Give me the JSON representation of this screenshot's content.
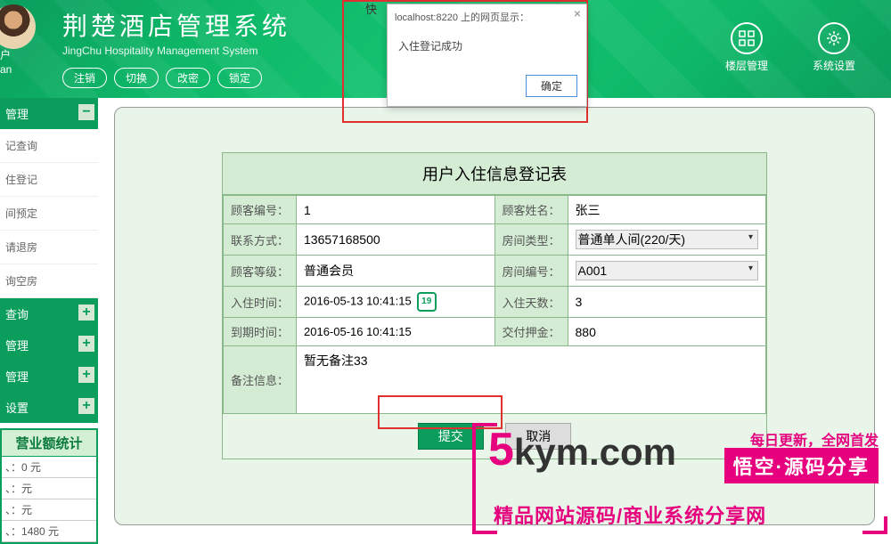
{
  "header": {
    "title": "荆楚酒店管理系统",
    "subtitle": "JingChu Hospitality Management System",
    "user_label_1": "户",
    "user_label_2": "an",
    "buttons": {
      "logout": "注销",
      "switch": "切换",
      "modify": "改密",
      "lock": "锁定"
    },
    "icons": {
      "floor": "楼层管理",
      "system": "系统设置"
    },
    "tab_hint": "快"
  },
  "alert": {
    "source": "localhost:8220 上的网页显示：",
    "message": "入住登记成功",
    "ok": "确定"
  },
  "sidebar": {
    "groups": [
      {
        "title": "管理",
        "expanded": true,
        "items": [
          "记查询",
          "住登记",
          "间预定",
          "请退房",
          "询空房"
        ]
      },
      {
        "title": "查询",
        "expanded": false
      },
      {
        "title": "管理",
        "expanded": false
      },
      {
        "title": "管理",
        "expanded": false
      },
      {
        "title": "设置",
        "expanded": false
      }
    ],
    "stats": {
      "title": "营业额统计",
      "rows": [
        {
          "label": "、：",
          "value": "0 元"
        },
        {
          "label": "、：",
          "value": "元"
        },
        {
          "label": "、：",
          "value": "元"
        },
        {
          "label": "、：",
          "value": "1480 元"
        }
      ]
    }
  },
  "form": {
    "title": "用户入住信息登记表",
    "labels": {
      "cust_id": "顾客编号：",
      "cust_name": "顾客姓名：",
      "contact": "联系方式：",
      "room_type": "房间类型：",
      "cust_level": "顾客等级：",
      "room_no": "房间编号：",
      "checkin": "入住时间：",
      "days": "入住天数：",
      "expire": "到期时间：",
      "deposit": "交付押金：",
      "remark": "备注信息："
    },
    "values": {
      "cust_id": "1",
      "cust_name": "张三",
      "contact": "13657168500",
      "room_type": "普通单人间(220/天)",
      "cust_level": "普通会员",
      "room_no": "A001",
      "checkin": "2016-05-13 10:41:15",
      "days": "3",
      "expire": "2016-05-16 10:41:15",
      "deposit": "880",
      "remark": "暂无备注33"
    },
    "buttons": {
      "submit": "提交",
      "cancel": "取消"
    }
  },
  "watermark": {
    "logo_5": "5",
    "logo_rest": "kym.com",
    "tag1": "每日更新，全网首发",
    "tag2": "悟空·源码分享",
    "sub": "精品网站源码/商业系统分享网"
  }
}
